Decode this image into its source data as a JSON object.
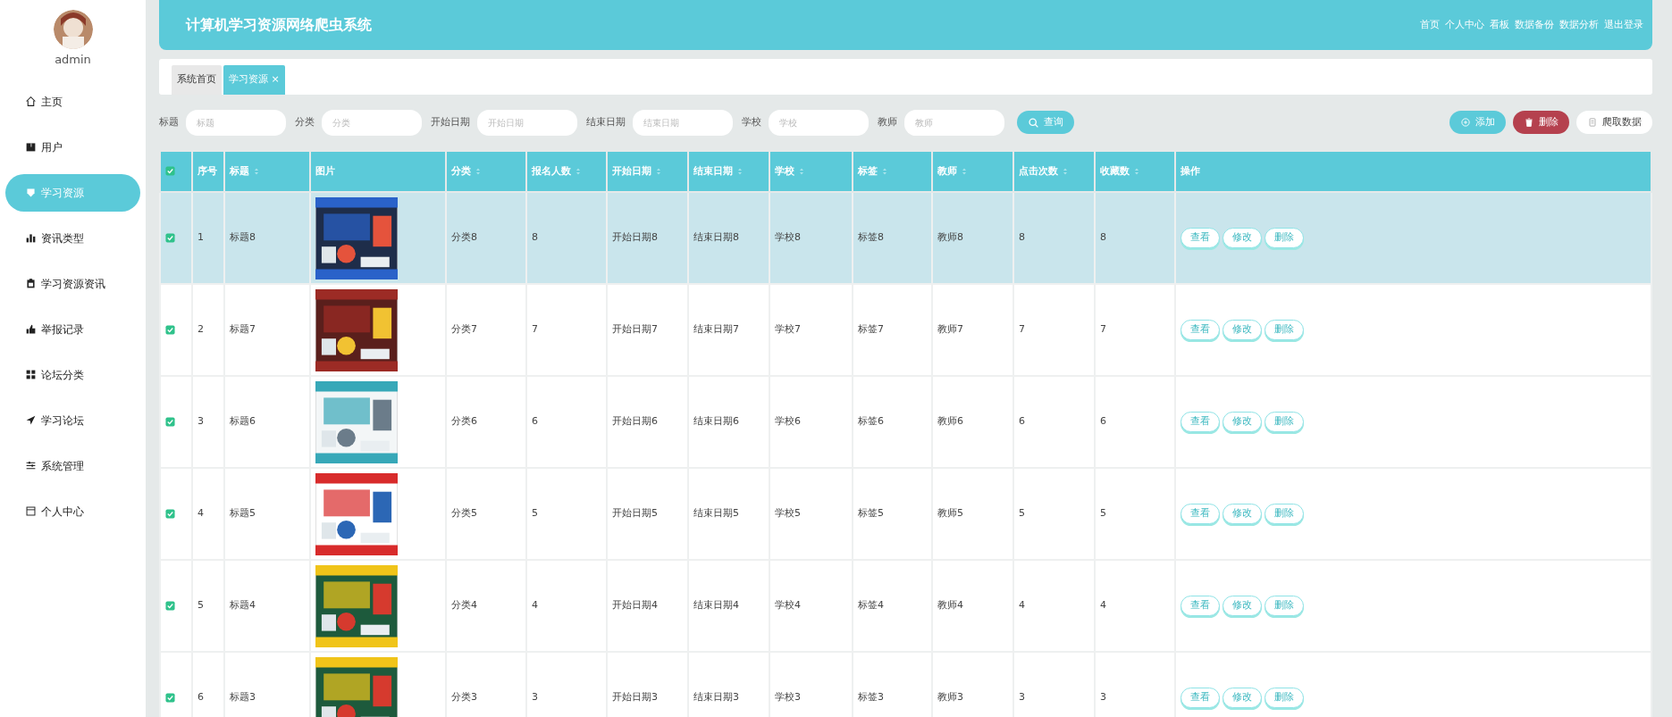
{
  "user": {
    "name": "admin"
  },
  "sidebar": {
    "items": [
      {
        "label": "主页",
        "selected": false
      },
      {
        "label": "用户",
        "selected": false
      },
      {
        "label": "学习资源",
        "selected": true
      },
      {
        "label": "资讯类型",
        "selected": false
      },
      {
        "label": "学习资源资讯",
        "selected": false
      },
      {
        "label": "举报记录",
        "selected": false
      },
      {
        "label": "论坛分类",
        "selected": false
      },
      {
        "label": "学习论坛",
        "selected": false
      },
      {
        "label": "系统管理",
        "selected": false
      },
      {
        "label": "个人中心",
        "selected": false
      }
    ]
  },
  "header": {
    "title": "计算机学习资源网络爬虫系统",
    "links": [
      "首页",
      "个人中心",
      "看板",
      "数据备份",
      "数据分析",
      "退出登录"
    ]
  },
  "tabs": [
    {
      "label": "系统首页",
      "selected": false
    },
    {
      "label": "学习资源",
      "selected": true,
      "close": "×"
    }
  ],
  "filters": [
    {
      "label": "标题",
      "placeholder": "标题"
    },
    {
      "label": "分类",
      "placeholder": "分类"
    },
    {
      "label": "开始日期",
      "placeholder": "开始日期"
    },
    {
      "label": "结束日期",
      "placeholder": "结束日期"
    },
    {
      "label": "学校",
      "placeholder": "学校"
    },
    {
      "label": "教师",
      "placeholder": "教师"
    }
  ],
  "search_button": "查询",
  "actions": [
    {
      "label": "添加",
      "kind": "add"
    },
    {
      "label": "删除",
      "kind": "delete"
    },
    {
      "label": "爬取数据",
      "kind": "crawl"
    }
  ],
  "table": {
    "all_checked": true,
    "columns": [
      {
        "label": "序号",
        "sortable": false
      },
      {
        "label": "标题",
        "sortable": true
      },
      {
        "label": "图片",
        "sortable": false
      },
      {
        "label": "分类",
        "sortable": true
      },
      {
        "label": "报名人数",
        "sortable": true
      },
      {
        "label": "开始日期",
        "sortable": true
      },
      {
        "label": "结束日期",
        "sortable": true
      },
      {
        "label": "学校",
        "sortable": true
      },
      {
        "label": "标签",
        "sortable": true
      },
      {
        "label": "教师",
        "sortable": true
      },
      {
        "label": "点击次数",
        "sortable": true
      },
      {
        "label": "收藏数",
        "sortable": true
      },
      {
        "label": "操作",
        "sortable": false
      }
    ],
    "rows": [
      {
        "checked": true,
        "selected": true,
        "cells": [
          "1",
          "标题8",
          {
            "kind": "picture"
          },
          "分类8",
          "8",
          "开始日期8",
          "结束日期8",
          "学校8",
          "标签8",
          "教师8",
          "8",
          "8"
        ],
        "buttons": [
          "查看",
          "修改",
          "删除"
        ]
      },
      {
        "checked": true,
        "selected": false,
        "cells": [
          "2",
          "标题7",
          {
            "kind": "picture"
          },
          "分类7",
          "7",
          "开始日期7",
          "结束日期7",
          "学校7",
          "标签7",
          "教师7",
          "7",
          "7"
        ],
        "buttons": [
          "查看",
          "修改",
          "删除"
        ]
      },
      {
        "checked": true,
        "selected": false,
        "cells": [
          "3",
          "标题6",
          {
            "kind": "picture"
          },
          "分类6",
          "6",
          "开始日期6",
          "结束日期6",
          "学校6",
          "标签6",
          "教师6",
          "6",
          "6"
        ],
        "buttons": [
          "查看",
          "修改",
          "删除"
        ]
      },
      {
        "checked": true,
        "selected": false,
        "cells": [
          "4",
          "标题5",
          {
            "kind": "picture"
          },
          "分类5",
          "5",
          "开始日期5",
          "结束日期5",
          "学校5",
          "标签5",
          "教师5",
          "5",
          "5"
        ],
        "buttons": [
          "查看",
          "修改",
          "删除"
        ]
      },
      {
        "checked": true,
        "selected": false,
        "cells": [
          "5",
          "标题4",
          {
            "kind": "picture"
          },
          "分类4",
          "4",
          "开始日期4",
          "结束日期4",
          "学校4",
          "标签4",
          "教师4",
          "4",
          "4"
        ],
        "buttons": [
          "查看",
          "修改",
          "删除"
        ]
      },
      {
        "checked": true,
        "selected": false,
        "cells": [
          "6",
          "标题3",
          {
            "kind": "picture"
          },
          "分类3",
          "3",
          "开始日期3",
          "结束日期3",
          "学校3",
          "标签3",
          "教师3",
          "3",
          "3"
        ],
        "buttons": [
          "查看",
          "修改",
          "删除"
        ]
      }
    ]
  }
}
